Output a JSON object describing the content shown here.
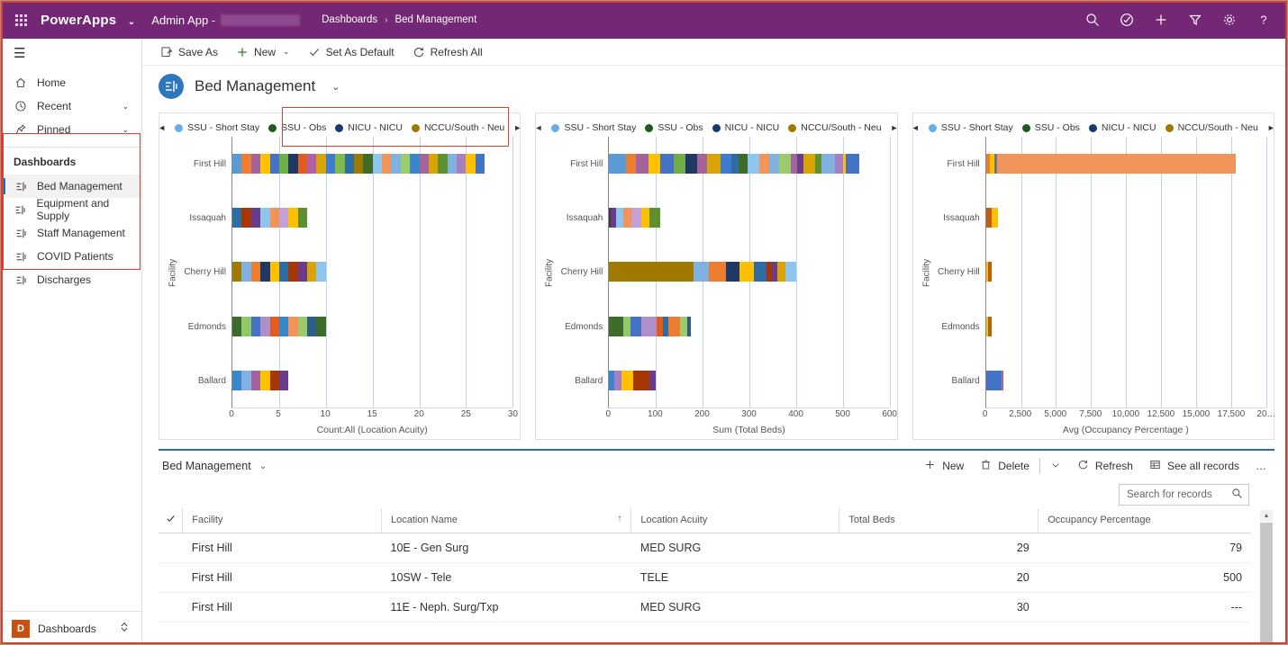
{
  "topbar": {
    "waffle_name": "app-launcher",
    "brand": "PowerApps",
    "app_name": "Admin App -",
    "breadcrumb": {
      "parent": "Dashboards",
      "separator": "›",
      "current": "Bed Management"
    },
    "icons": [
      "search-icon",
      "check-circle-icon",
      "plus-icon",
      "filter-icon",
      "gear-icon",
      "help-icon"
    ]
  },
  "sidebar": {
    "nav": [
      {
        "label": "Home",
        "icon": "home-icon",
        "chevron": ""
      },
      {
        "label": "Recent",
        "icon": "clock-icon",
        "chevron": "⌄"
      },
      {
        "label": "Pinned",
        "icon": "pin-icon",
        "chevron": "⌄"
      }
    ],
    "section_title": "Dashboards",
    "dashboards": [
      {
        "label": "Bed Management",
        "active": true
      },
      {
        "label": "Equipment and Supply",
        "active": false
      },
      {
        "label": "Staff Management",
        "active": false
      },
      {
        "label": "COVID Patients",
        "active": false
      },
      {
        "label": "Discharges",
        "active": false
      }
    ],
    "bottom": {
      "badge": "D",
      "label": "Dashboards",
      "chevron": "⌃⌄"
    }
  },
  "commandbar": [
    {
      "label": "Save As",
      "icon": "save-as-icon",
      "dropdown": false
    },
    {
      "label": "New",
      "icon": "plus-icon",
      "dropdown": true
    },
    {
      "label": "Set As Default",
      "icon": "check-icon",
      "dropdown": false
    },
    {
      "label": "Refresh All",
      "icon": "refresh-icon",
      "dropdown": false
    }
  ],
  "dashboard_header": {
    "title": "Bed Management",
    "chevron": "⌄",
    "icon": "dashboard-icon"
  },
  "legend_series": [
    {
      "label": "SSU - Short Stay",
      "color": "#6aace4"
    },
    {
      "label": "SSU - Obs",
      "color": "#1e5a1e"
    },
    {
      "label": "NICU - NICU",
      "color": "#173a6e"
    },
    {
      "label": "NCCU/South - Neu",
      "color": "#a07a00"
    }
  ],
  "chart_data": [
    {
      "type": "bar",
      "title": "",
      "orientation": "horizontal",
      "stacked": true,
      "xlabel": "Count:All (Location Acuity)",
      "ylabel": "Facility",
      "categories": [
        "First Hill",
        "Issaquah",
        "Cherry Hill",
        "Edmonds",
        "Ballard"
      ],
      "values": [
        27,
        8,
        10,
        10,
        6
      ],
      "xticks": [
        "0",
        "5",
        "10",
        "15",
        "20",
        "25",
        "30"
      ],
      "xlim": [
        0,
        30
      ],
      "grid": true,
      "legend_position": "top",
      "segments": [
        [
          {
            "c": "#5b9bd5",
            "v": 1
          },
          {
            "c": "#ed7d31",
            "v": 1
          },
          {
            "c": "#a5639c",
            "v": 1
          },
          {
            "c": "#ffc000",
            "v": 1
          },
          {
            "c": "#4472c4",
            "v": 1
          },
          {
            "c": "#70ad47",
            "v": 1
          },
          {
            "c": "#1f3864",
            "v": 1
          },
          {
            "c": "#e15c1e",
            "v": 1
          },
          {
            "c": "#b05fa8",
            "v": 1
          },
          {
            "c": "#d9a404",
            "v": 1
          },
          {
            "c": "#3f7ccf",
            "v": 1
          },
          {
            "c": "#7fbb4b",
            "v": 1
          },
          {
            "c": "#2e6da4",
            "v": 1
          },
          {
            "c": "#a07a00",
            "v": 1
          },
          {
            "c": "#3d6b2a",
            "v": 1
          },
          {
            "c": "#8ec5ee",
            "v": 1
          },
          {
            "c": "#f2945a",
            "v": 1
          },
          {
            "c": "#7fb2e0",
            "v": 1
          },
          {
            "c": "#9ccb6a",
            "v": 1
          },
          {
            "c": "#3a86cc",
            "v": 1
          },
          {
            "c": "#a5639c",
            "v": 1
          },
          {
            "c": "#d9a404",
            "v": 1
          },
          {
            "c": "#5d9130",
            "v": 1
          },
          {
            "c": "#7fb2e0",
            "v": 1
          },
          {
            "c": "#a57fbf",
            "v": 1
          },
          {
            "c": "#ffc000",
            "v": 1
          },
          {
            "c": "#4472c4",
            "v": 1
          }
        ],
        [
          {
            "c": "#2e6da4",
            "v": 1
          },
          {
            "c": "#a63603",
            "v": 1
          },
          {
            "c": "#6a3d8c",
            "v": 1
          },
          {
            "c": "#8ec5ee",
            "v": 1
          },
          {
            "c": "#f2945a",
            "v": 1
          },
          {
            "c": "#c4a0d6",
            "v": 1
          },
          {
            "c": "#ffc000",
            "v": 1
          },
          {
            "c": "#5d9130",
            "v": 1
          }
        ],
        [
          {
            "c": "#a07a00",
            "v": 1
          },
          {
            "c": "#7fb2e0",
            "v": 1
          },
          {
            "c": "#ed7d31",
            "v": 1
          },
          {
            "c": "#1f3864",
            "v": 1
          },
          {
            "c": "#ffc000",
            "v": 1
          },
          {
            "c": "#2e6da4",
            "v": 1
          },
          {
            "c": "#a63603",
            "v": 1
          },
          {
            "c": "#6a3d8c",
            "v": 1
          },
          {
            "c": "#d9a404",
            "v": 1
          },
          {
            "c": "#8ec5ee",
            "v": 1
          }
        ],
        [
          {
            "c": "#3d6b2a",
            "v": 1
          },
          {
            "c": "#8fc96a",
            "v": 1
          },
          {
            "c": "#4472c4",
            "v": 1
          },
          {
            "c": "#b08ec9",
            "v": 1
          },
          {
            "c": "#e15c1e",
            "v": 1
          },
          {
            "c": "#3a86cc",
            "v": 1
          },
          {
            "c": "#f2945a",
            "v": 1
          },
          {
            "c": "#9ccb6a",
            "v": 1
          },
          {
            "c": "#2e5f8a",
            "v": 1
          },
          {
            "c": "#3d6b2a",
            "v": 1
          }
        ],
        [
          {
            "c": "#3a86cc",
            "v": 1
          },
          {
            "c": "#7fb2e0",
            "v": 1
          },
          {
            "c": "#a5639c",
            "v": 1
          },
          {
            "c": "#ffc000",
            "v": 1
          },
          {
            "c": "#a63603",
            "v": 1
          },
          {
            "c": "#6a3d8c",
            "v": 1
          }
        ]
      ]
    },
    {
      "type": "bar",
      "title": "",
      "orientation": "horizontal",
      "stacked": true,
      "xlabel": "Sum (Total Beds)",
      "ylabel": "Facility",
      "categories": [
        "First Hill",
        "Issaquah",
        "Cherry Hill",
        "Edmonds",
        "Ballard"
      ],
      "values": [
        565,
        110,
        400,
        175,
        100
      ],
      "xticks": [
        "0",
        "100",
        "200",
        "300",
        "400",
        "500",
        "600"
      ],
      "xlim": [
        0,
        600
      ],
      "grid": true,
      "legend_position": "top",
      "segments": [
        [
          {
            "c": "#5b9bd5",
            "v": 36
          },
          {
            "c": "#ed7d31",
            "v": 22
          },
          {
            "c": "#a5639c",
            "v": 26
          },
          {
            "c": "#ffc000",
            "v": 26
          },
          {
            "c": "#4472c4",
            "v": 28
          },
          {
            "c": "#70ad47",
            "v": 26
          },
          {
            "c": "#1f3864",
            "v": 24
          },
          {
            "c": "#a5639c",
            "v": 21
          },
          {
            "c": "#d9a404",
            "v": 30
          },
          {
            "c": "#3f7ccf",
            "v": 22
          },
          {
            "c": "#2e6da4",
            "v": 16
          },
          {
            "c": "#3d6b2a",
            "v": 20
          },
          {
            "c": "#8ec5ee",
            "v": 24
          },
          {
            "c": "#f2945a",
            "v": 22
          },
          {
            "c": "#7fb2e0",
            "v": 20
          },
          {
            "c": "#9ccb6a",
            "v": 26
          },
          {
            "c": "#a5639c",
            "v": 14
          },
          {
            "c": "#6a3d8c",
            "v": 12
          },
          {
            "c": "#d9a404",
            "v": 26
          },
          {
            "c": "#5d9130",
            "v": 14
          },
          {
            "c": "#7fb2e0",
            "v": 28
          },
          {
            "c": "#a57fbf",
            "v": 18
          },
          {
            "c": "#ffc000",
            "v": 6
          },
          {
            "c": "#4472c4",
            "v": 28
          }
        ],
        [
          {
            "c": "#3d3d3d",
            "v": 4
          },
          {
            "c": "#6a3d8c",
            "v": 10
          },
          {
            "c": "#8ec5ee",
            "v": 16
          },
          {
            "c": "#f2945a",
            "v": 18
          },
          {
            "c": "#c4a0d6",
            "v": 20
          },
          {
            "c": "#ffc000",
            "v": 18
          },
          {
            "c": "#5d9130",
            "v": 24
          }
        ],
        [
          {
            "c": "#a07a00",
            "v": 180
          },
          {
            "c": "#7fb2e0",
            "v": 33
          },
          {
            "c": "#ed7d31",
            "v": 36
          },
          {
            "c": "#1f3864",
            "v": 30
          },
          {
            "c": "#ffc000",
            "v": 30
          },
          {
            "c": "#2e6da4",
            "v": 28
          },
          {
            "c": "#a63603",
            "v": 12
          },
          {
            "c": "#6a3d8c",
            "v": 10
          },
          {
            "c": "#d9a404",
            "v": 18
          },
          {
            "c": "#8ec5ee",
            "v": 23
          }
        ],
        [
          {
            "c": "#3d6b2a",
            "v": 30
          },
          {
            "c": "#8fc96a",
            "v": 16
          },
          {
            "c": "#4472c4",
            "v": 22
          },
          {
            "c": "#b08ec9",
            "v": 34
          },
          {
            "c": "#e15c1e",
            "v": 14
          },
          {
            "c": "#2e6da4",
            "v": 10
          },
          {
            "c": "#ed7d31",
            "v": 26
          },
          {
            "c": "#9ccb6a",
            "v": 16
          },
          {
            "c": "#2e5f8a",
            "v": 7
          }
        ],
        [
          {
            "c": "#3a86cc",
            "v": 10
          },
          {
            "c": "#a57fbf",
            "v": 16
          },
          {
            "c": "#ffc000",
            "v": 26
          },
          {
            "c": "#a63603",
            "v": 34
          },
          {
            "c": "#6a3d8c",
            "v": 14
          }
        ]
      ]
    },
    {
      "type": "bar",
      "title": "",
      "orientation": "horizontal",
      "stacked": true,
      "xlabel": "Avg (Occupancy Percentage )",
      "ylabel": "Facility",
      "categories": [
        "First Hill",
        "Issaquah",
        "Cherry Hill",
        "Edmonds",
        "Ballard"
      ],
      "values": [
        17800,
        830,
        400,
        400,
        1250
      ],
      "xticks": [
        "0",
        "2,500",
        "5,000",
        "7,500",
        "10,000",
        "12,500",
        "15,000",
        "17,500",
        "20…"
      ],
      "xlim": [
        0,
        20000
      ],
      "grid": true,
      "legend_position": "top",
      "segments": [
        [
          {
            "c": "#ed7d31",
            "v": 290
          },
          {
            "c": "#ffc000",
            "v": 290
          },
          {
            "c": "#5d9130",
            "v": 70
          },
          {
            "c": "#4472c4",
            "v": 80
          },
          {
            "c": "#a5639c",
            "v": 70
          },
          {
            "c": "#f0945a",
            "v": 17000
          }
        ],
        [
          {
            "c": "#c55a11",
            "v": 420
          },
          {
            "c": "#ffc000",
            "v": 410
          }
        ],
        [
          {
            "c": "#ffc000",
            "v": 130
          },
          {
            "c": "#c55a11",
            "v": 270
          }
        ],
        [
          {
            "c": "#ffc000",
            "v": 120
          },
          {
            "c": "#5d9130",
            "v": 120
          },
          {
            "c": "#c55a11",
            "v": 160
          }
        ],
        [
          {
            "c": "#4472c4",
            "v": 1100
          },
          {
            "c": "#a57fbf",
            "v": 100
          },
          {
            "c": "#c0504d",
            "v": 50
          }
        ]
      ]
    }
  ],
  "grid_panel": {
    "view_name": "Bed Management",
    "view_chevron": "⌄",
    "commands": [
      {
        "label": "New",
        "icon": "plus-icon",
        "dropdown": false
      },
      {
        "label": "Delete",
        "icon": "trash-icon",
        "dropdown": true
      },
      {
        "label": "Refresh",
        "icon": "refresh-icon",
        "dropdown": false
      },
      {
        "label": "See all records",
        "icon": "table-icon",
        "dropdown": false
      },
      {
        "label": "…",
        "icon": "overflow-icon",
        "dropdown": false
      }
    ],
    "search_placeholder": "Search for records",
    "search_value": "",
    "columns": [
      {
        "label": "Facility",
        "align": "left",
        "sorted": false
      },
      {
        "label": "Location Name",
        "align": "left",
        "sorted": true,
        "sort_dir": "↑"
      },
      {
        "label": "Location Acuity",
        "align": "left",
        "sorted": false
      },
      {
        "label": "Total Beds",
        "align": "right",
        "sorted": false
      },
      {
        "label": "Occupancy Percentage",
        "align": "right",
        "sorted": false
      }
    ],
    "rows": [
      {
        "facility": "First Hill",
        "location_name": "10E - Gen Surg",
        "location_acuity": "MED SURG",
        "total_beds": "29",
        "occupancy": "79"
      },
      {
        "facility": "First Hill",
        "location_name": "10SW - Tele",
        "location_acuity": "TELE",
        "total_beds": "20",
        "occupancy": "500"
      },
      {
        "facility": "First Hill",
        "location_name": "11E - Neph. Surg/Txp",
        "location_acuity": "MED SURG",
        "total_beds": "30",
        "occupancy": "---"
      }
    ]
  },
  "colors": {
    "brand_purple": "#742774",
    "accent_blue": "#2266aa",
    "highlight_red": "#e23c28",
    "grid_line": "#bcd4ee"
  }
}
